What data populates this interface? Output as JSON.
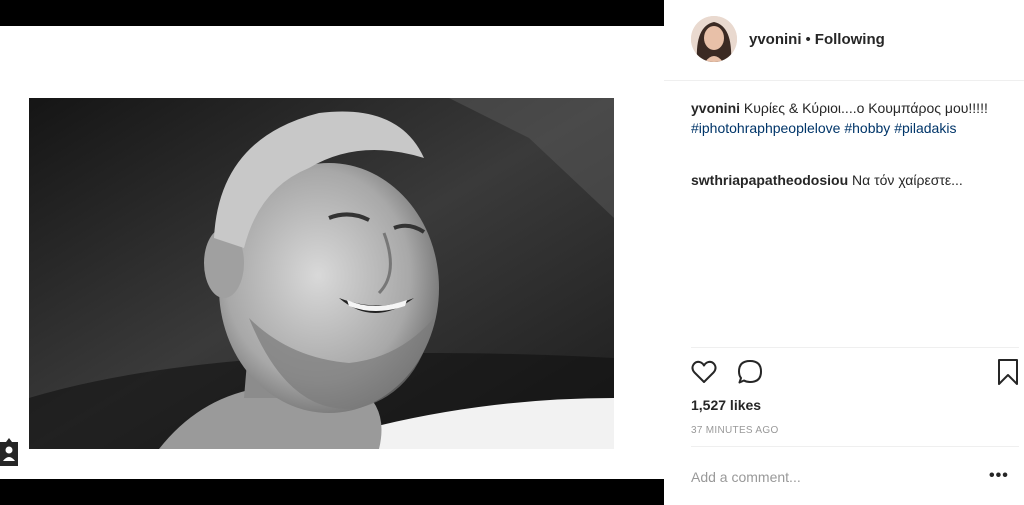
{
  "post": {
    "username": "yvonini",
    "separator": "•",
    "follow_status": "Following",
    "caption_text": "Κυρίες & Κύριοι....ο Κουμπάρος μου!!!!! ",
    "hashtags": [
      "#iphotohraphpeoplelove",
      "#hobby",
      "#piladakis"
    ],
    "comments": [
      {
        "username": "swthriapapatheodosiou",
        "text": "Να τόν χαίρεστε..."
      }
    ],
    "likes": "1,527 likes",
    "time_ago": "37 MINUTES AGO",
    "add_comment_placeholder": "Add a comment...",
    "more_label": "•••"
  },
  "icons": {
    "like": "heart-icon",
    "comment": "comment-icon",
    "save": "bookmark-icon",
    "tag": "user-tag-icon"
  },
  "colors": {
    "hashtag": "#003569",
    "muted": "#999999",
    "text": "#262626"
  }
}
